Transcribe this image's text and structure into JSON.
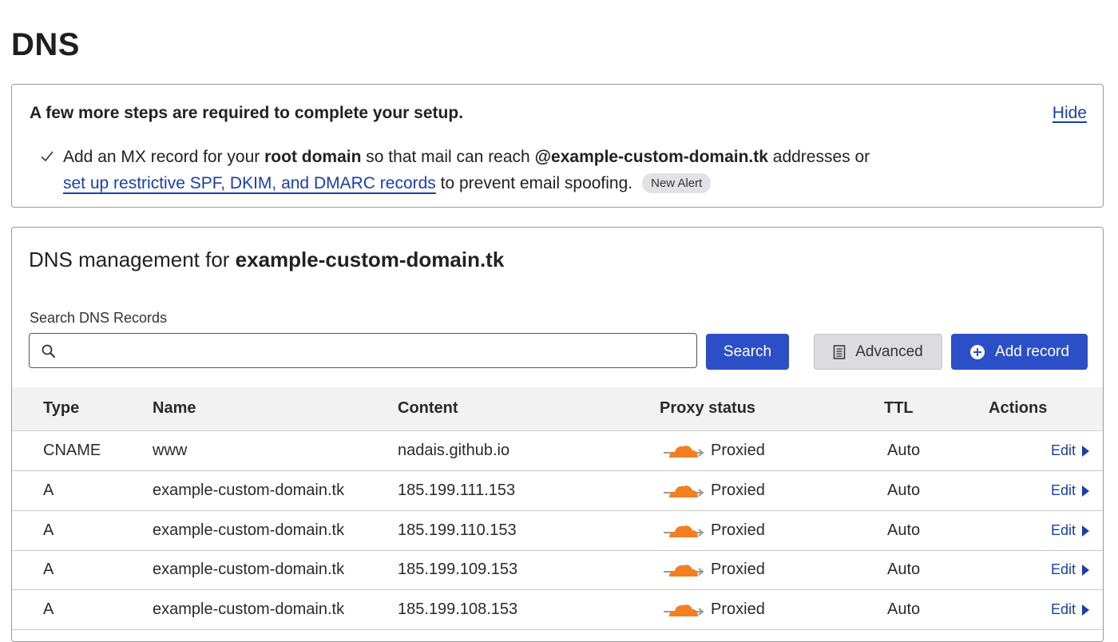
{
  "page": {
    "title": "DNS"
  },
  "setup_alert": {
    "heading": "A few more steps are required to complete your setup.",
    "hide_label": "Hide",
    "line1_prefix": "Add an MX record for your ",
    "line1_bold1": "root domain",
    "line1_mid": " so that mail can reach ",
    "line1_bold2": "@example-custom-domain.tk",
    "line1_suffix": " addresses or",
    "line2_link": "set up restrictive SPF, DKIM, and DMARC records",
    "line2_suffix": " to prevent email spoofing.",
    "badge": "New Alert",
    "check_icon": "check-icon"
  },
  "management": {
    "title_prefix": "DNS management for ",
    "domain": "example-custom-domain.tk",
    "search_label": "Search DNS Records",
    "search_placeholder": "",
    "search_button": "Search",
    "advanced_button": "Advanced",
    "add_record_button": "Add record"
  },
  "table": {
    "headers": {
      "type": "Type",
      "name": "Name",
      "content": "Content",
      "proxy": "Proxy status",
      "ttl": "TTL",
      "actions": "Actions"
    },
    "rows": [
      {
        "type": "CNAME",
        "name": "www",
        "content": "nadais.github.io",
        "proxy": "Proxied",
        "ttl": "Auto",
        "action": "Edit"
      },
      {
        "type": "A",
        "name": "example-custom-domain.tk",
        "content": "185.199.111.153",
        "proxy": "Proxied",
        "ttl": "Auto",
        "action": "Edit"
      },
      {
        "type": "A",
        "name": "example-custom-domain.tk",
        "content": "185.199.110.153",
        "proxy": "Proxied",
        "ttl": "Auto",
        "action": "Edit"
      },
      {
        "type": "A",
        "name": "example-custom-domain.tk",
        "content": "185.199.109.153",
        "proxy": "Proxied",
        "ttl": "Auto",
        "action": "Edit"
      },
      {
        "type": "A",
        "name": "example-custom-domain.tk",
        "content": "185.199.108.153",
        "proxy": "Proxied",
        "ttl": "Auto",
        "action": "Edit"
      }
    ]
  },
  "colors": {
    "primary": "#2c4ec7",
    "link": "#1a3fa8",
    "cloud": "#f38020",
    "badge_bg": "#e2e2e6"
  }
}
